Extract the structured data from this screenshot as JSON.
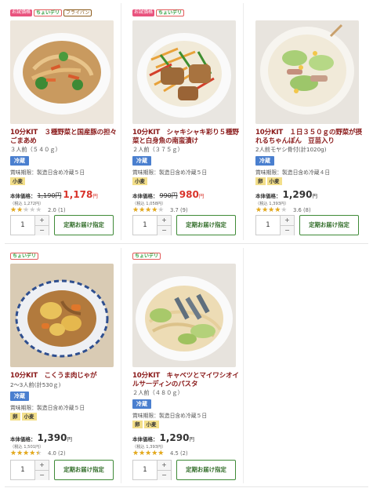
{
  "labels": {
    "price_label": "本体価格：",
    "yen": "円",
    "qty_plus": "+",
    "qty_minus": "−",
    "order_button": "定期お届け指定"
  },
  "products": [
    {
      "badges": [
        {
          "text": "お試価格",
          "style": "red"
        },
        {
          "text": "ちょいデリ",
          "style": "green"
        },
        {
          "text": "フライパン",
          "style": "tan"
        }
      ],
      "title": "10分KIT　３種野菜と国産豚の担々ごまあめ",
      "portion": "３人前（５４０ｇ）",
      "storage": "冷蔵",
      "expiry": "賞味期限：製造日含め冷蔵５日",
      "allergens": [
        "小麦"
      ],
      "price_old": "1,190円",
      "price_new": "1,178",
      "tax_included": "（税込 1,272円）",
      "rating_value": 2.0,
      "rating_text": "2.0 (1)",
      "quantity": "1"
    },
    {
      "badges": [
        {
          "text": "お試価格",
          "style": "red"
        },
        {
          "text": "ちょいデリ",
          "style": "green"
        }
      ],
      "title": "10分KIT　シャキシャキ彩り５種野菜と白身魚の南蛮漬け",
      "portion": "２人前（３７５ｇ）",
      "storage": "冷蔵",
      "expiry": "賞味期限：製造日含め冷蔵５日",
      "allergens": [
        "小麦"
      ],
      "price_old": "990円",
      "price_new": "980",
      "tax_included": "（税込 1,058円）",
      "rating_value": 3.7,
      "rating_text": "3.7 (9)",
      "quantity": "1"
    },
    {
      "badges": [],
      "title": "10分KIT　１日３５０ｇの野菜が摂れるちゃんぽん　豆苗入り",
      "portion": "2人前モヤシ骨付(計1020g)",
      "storage": "冷蔵",
      "expiry": "賞味期限：製造日含め冷蔵４日",
      "allergens": [
        "卵",
        "小麦"
      ],
      "price_old": "",
      "price_new": "1,290",
      "tax_included": "（税込 1,393円）",
      "rating_value": 3.6,
      "rating_text": "3.6 (8)",
      "quantity": "1"
    },
    {
      "badges": [
        {
          "text": "ちょいデリ",
          "style": "green"
        }
      ],
      "title": "10分KIT　こくうま肉じゃが",
      "portion": "2～3人前(計530ｇ)",
      "storage": "冷蔵",
      "expiry": "賞味期限：製造日含め冷蔵５日",
      "allergens": [
        "卵",
        "小麦"
      ],
      "price_old": "",
      "price_new": "1,390",
      "tax_included": "（税込 1,501円）",
      "rating_value": 4.0,
      "rating_text": "4.0 (2)",
      "quantity": "1"
    },
    {
      "badges": [
        {
          "text": "ちょいデリ",
          "style": "green"
        }
      ],
      "title": "10分KIT　キャベツとマイワシオイルサーディンのパスタ",
      "portion": "２人前（４８０ｇ）",
      "storage": "冷蔵",
      "expiry": "賞味期限：製造日含め冷蔵５日",
      "allergens": [
        "卵",
        "小麦"
      ],
      "price_old": "",
      "price_new": "1,290",
      "tax_included": "（税込 1,393円）",
      "rating_value": 4.5,
      "rating_text": "4.5 (2)",
      "quantity": "1"
    }
  ]
}
